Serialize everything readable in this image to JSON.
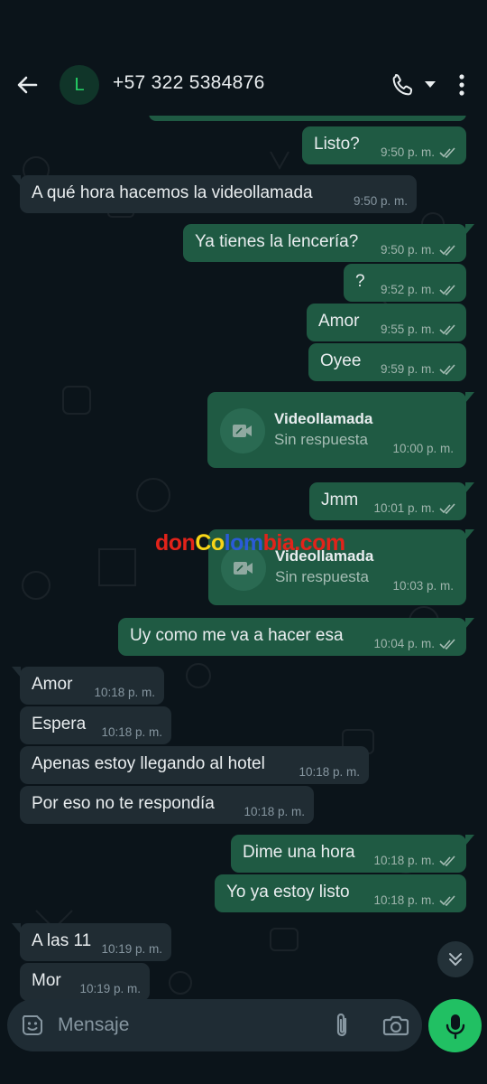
{
  "header": {
    "avatar_letter": "L",
    "contact": "+57 322 5384876"
  },
  "colors": {
    "background": "#0b141a",
    "outgoing_bubble": "#1f5a43",
    "incoming_bubble": "#202c33",
    "accent_green": "#21c063"
  },
  "messages": [
    {
      "dir": "out",
      "text": "Listo?",
      "time": "9:50 p. m."
    },
    {
      "dir": "in",
      "text": "A qué hora hacemos la videollamada",
      "time": "9:50 p. m."
    },
    {
      "dir": "out",
      "text": "Ya tienes la lencería?",
      "time": "9:50 p. m."
    },
    {
      "dir": "out",
      "text": "?",
      "time": "9:52 p. m."
    },
    {
      "dir": "out",
      "text": "Amor",
      "time": "9:55 p. m."
    },
    {
      "dir": "out",
      "text": "Oyee",
      "time": "9:59 p. m."
    },
    {
      "dir": "out",
      "text": "Jmm",
      "time": "10:01 p. m."
    },
    {
      "dir": "out",
      "text": "Uy como me va a hacer esa",
      "time": "10:04 p. m."
    },
    {
      "dir": "in",
      "text": "Amor",
      "time": "10:18 p. m."
    },
    {
      "dir": "in",
      "text": "Espera",
      "time": "10:18 p. m."
    },
    {
      "dir": "in",
      "text": "Apenas estoy llegando al hotel",
      "time": "10:18 p. m."
    },
    {
      "dir": "in",
      "text": "Por eso no te respondía",
      "time": "10:18 p. m."
    },
    {
      "dir": "out",
      "text": "Dime una hora",
      "time": "10:18 p. m."
    },
    {
      "dir": "out",
      "text": "Yo ya estoy listo",
      "time": "10:18 p. m."
    },
    {
      "dir": "in",
      "text": "A las 11",
      "time": "10:19 p. m."
    },
    {
      "dir": "in",
      "text": "Mor",
      "time": "10:19 p. m."
    }
  ],
  "calls": [
    {
      "title": "Videollamada",
      "status": "Sin respuesta",
      "time": "10:00 p. m."
    },
    {
      "title": "Videollamada",
      "status": "Sin respuesta",
      "time": "10:03 p. m."
    }
  ],
  "watermark": {
    "part1": "don",
    "part2": "Co",
    "part3": "lom",
    "part4": "bia",
    "part5": ".com"
  },
  "composer": {
    "placeholder": "Mensaje"
  }
}
